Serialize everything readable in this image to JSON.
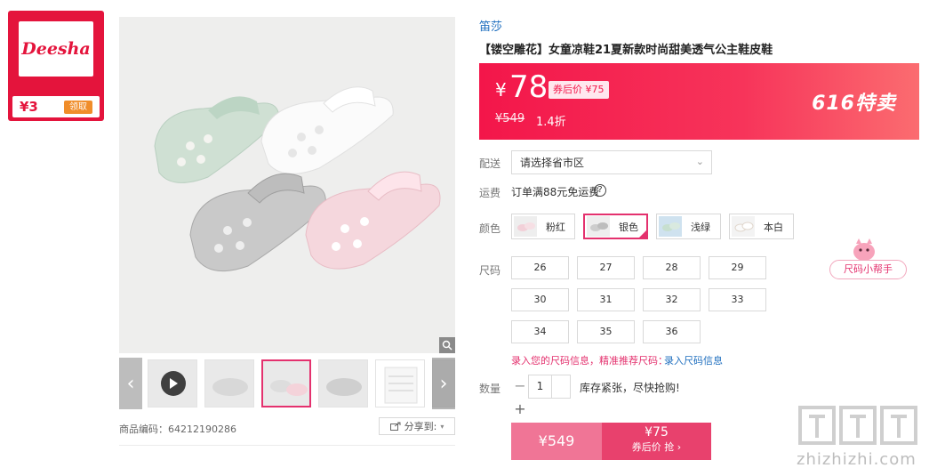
{
  "brand_card": {
    "logo_text": "Deesha",
    "coupon_amount": "¥3",
    "coupon_claim": "领取"
  },
  "product": {
    "brand": "笛莎",
    "title": "【镂空雕花】女童凉鞋21夏新款时尚甜美透气公主鞋皮鞋",
    "sku_label": "商品编码：",
    "sku_value": "64212190286",
    "share_label": "分享到:"
  },
  "price": {
    "yen": "¥",
    "current": "78",
    "after_coupon": "券后价 ¥75",
    "original": "¥549",
    "discount": "1.4折",
    "promo": "616特卖"
  },
  "labels": {
    "delivery": "配送",
    "shipping": "运费",
    "color": "颜色",
    "size": "尺码",
    "quantity": "数量"
  },
  "delivery": {
    "placeholder": "请选择省市区"
  },
  "shipping_text": "订单满88元免运费",
  "colors": [
    {
      "name": "粉红",
      "selected": false
    },
    {
      "name": "银色",
      "selected": true
    },
    {
      "name": "浅绿",
      "selected": false
    },
    {
      "name": "本白",
      "selected": false
    }
  ],
  "sizes": [
    "26",
    "27",
    "28",
    "29",
    "30",
    "31",
    "32",
    "33",
    "34",
    "35",
    "36"
  ],
  "size_helper": "尺码小帮手",
  "size_note": "录入您的尺码信息，精准推荐尺码：",
  "size_note_link": "录入尺码信息",
  "quantity": {
    "value": "1",
    "minus": "−",
    "plus": "+",
    "stock_msg": "库存紧张，尽快抢购!"
  },
  "buttons": {
    "left_price": "¥549",
    "right_price": "¥75",
    "right_label": "券后价 抢 ›"
  },
  "watermark": {
    "text": "zhizhizhi.com"
  },
  "colors_theme": {
    "accent": "#e4316e",
    "brand_red": "#e4143c",
    "link_blue": "#1f6fbf"
  }
}
